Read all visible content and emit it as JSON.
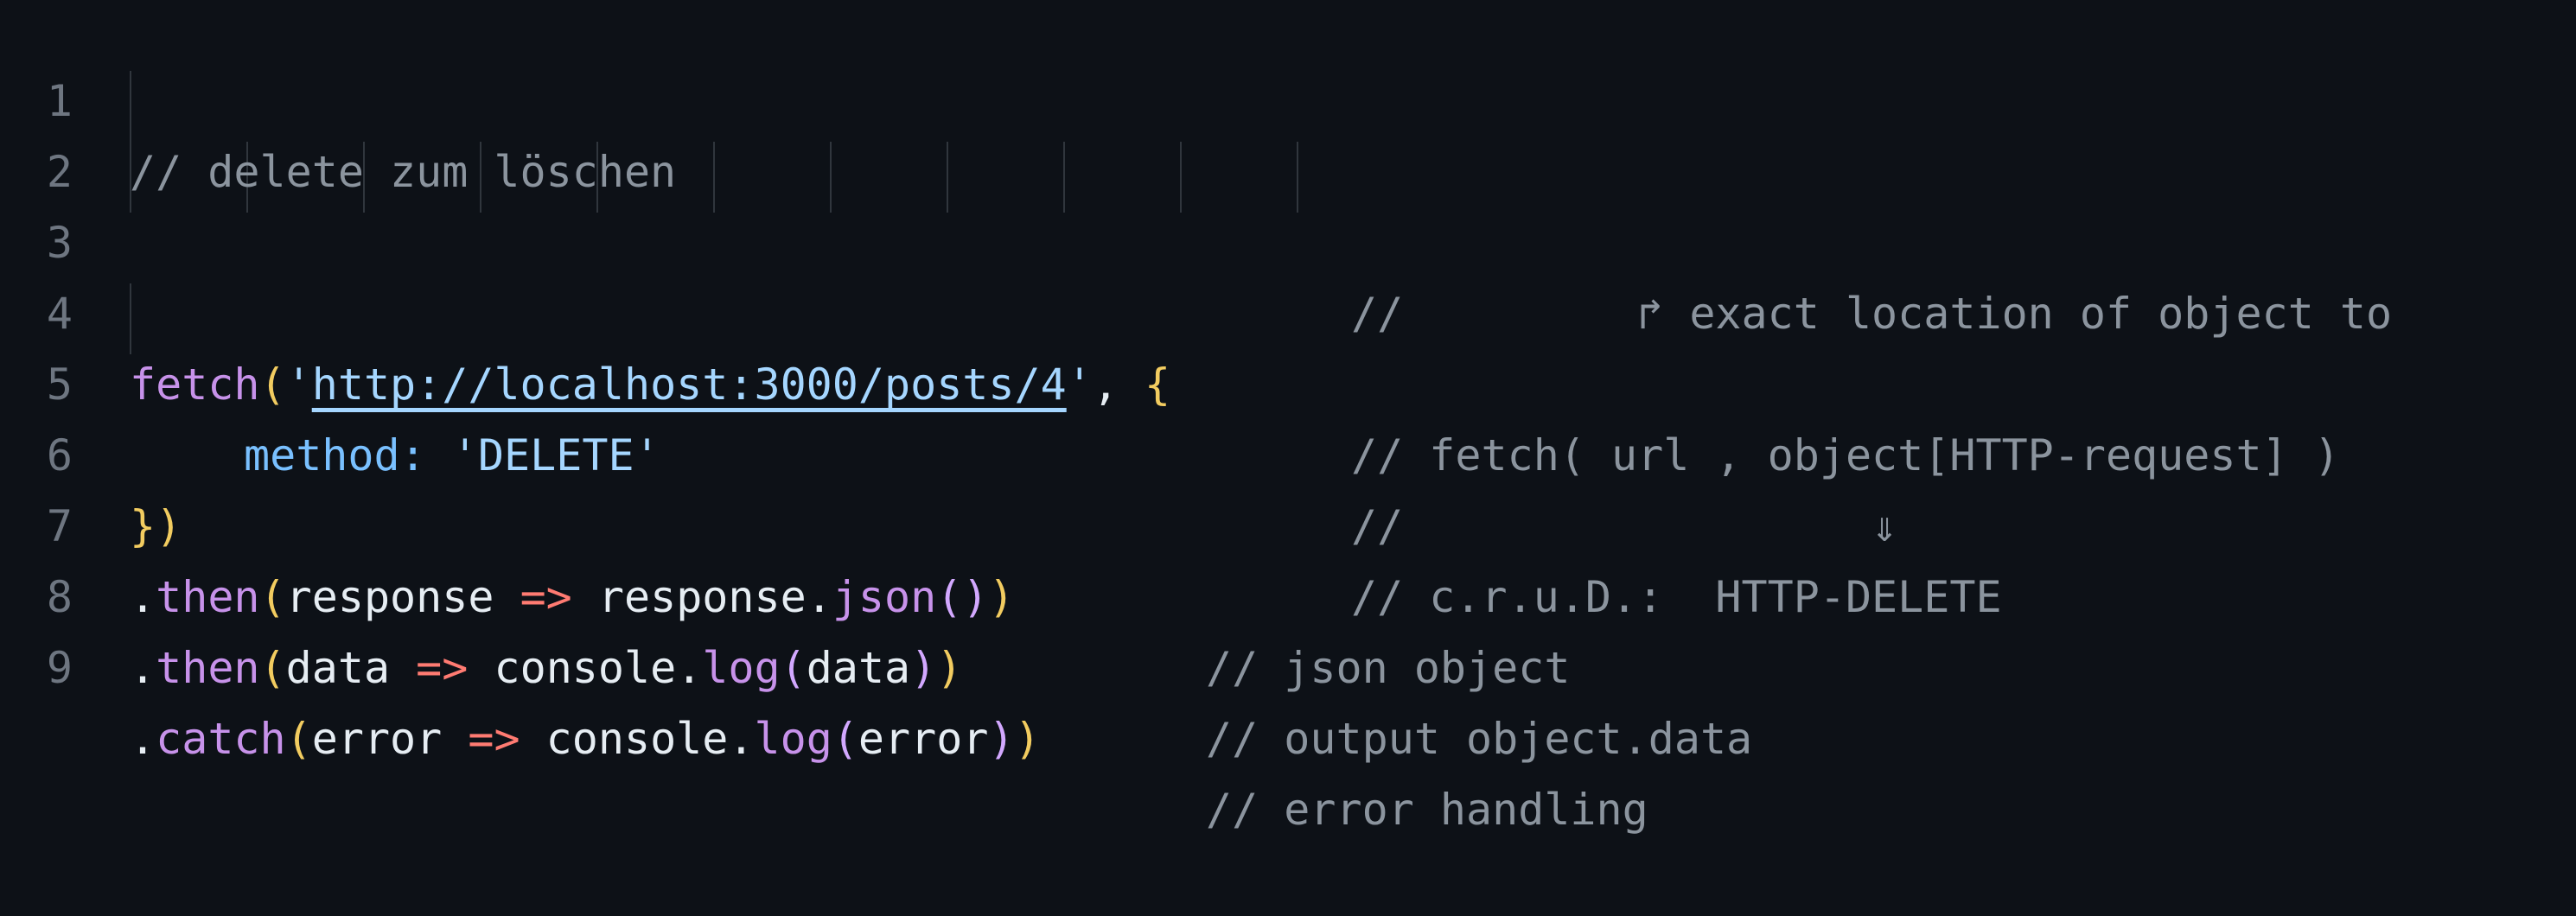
{
  "editor": {
    "lines": [
      {
        "num": "1",
        "comment": "// delete zum löschen"
      },
      {
        "num": "2"
      },
      {
        "num": "3",
        "comment": "//         ↱ exact location of object to"
      },
      {
        "num": "4",
        "fetch": "fetch",
        "paren_open": "(",
        "quote_open": "'",
        "url": "http://localhost:3000/posts/4",
        "quote_close": "'",
        "comma": ", ",
        "brace": "{",
        "comment": "// fetch( url , object[HTTP-request] )"
      },
      {
        "num": "5",
        "prop": "method",
        "colon": ": ",
        "value": "'DELETE'",
        "comment": "//                  ⇓"
      },
      {
        "num": "6",
        "close_brace": "}",
        "close_paren": ")",
        "comment": "// c.r.u.D.:  HTTP-DELETE"
      },
      {
        "num": "7",
        "dot": ".",
        "method": "then",
        "p1": "(",
        "arg": "response",
        "arrow": " => ",
        "body1": "response.",
        "body_method": "json",
        "p2": "()",
        "p3": ")",
        "comment": "// json object"
      },
      {
        "num": "8",
        "dot": ".",
        "method": "then",
        "p1": "(",
        "arg": "data",
        "arrow": " => ",
        "body1": "console.",
        "body_method": "log",
        "p2open": "(",
        "inner": "data",
        "p2close": ")",
        "p3": ")",
        "comment": "// output object.data"
      },
      {
        "num": "9",
        "dot": ".",
        "method": "catch",
        "p1": "(",
        "arg": "error",
        "arrow": " => ",
        "body1": "console.",
        "body_method": "log",
        "p2open": "(",
        "inner": "error",
        "p2close": ")",
        "p3": ")",
        "comment": "// error handling"
      }
    ]
  },
  "theme": {
    "background": "#0d1117",
    "line_number": "#6e7681",
    "comment": "#8b949e",
    "string": "#a5d6ff",
    "function": "#c792ea",
    "property": "#79c0ff",
    "arrow": "#ff7b72",
    "bracket_level1": "#f2cc60",
    "bracket_level2": "#d2a8ff"
  }
}
